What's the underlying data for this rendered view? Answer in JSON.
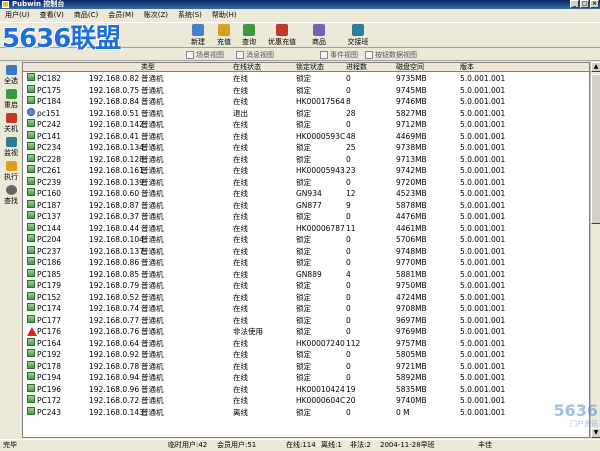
{
  "window": {
    "title": "Pubwin 控制台"
  },
  "menu": [
    "用户(U)",
    "查看(V)",
    "商品(C)",
    "会员(M)",
    "账次(Z)",
    "系统(S)",
    "帮助(H)"
  ],
  "logo": {
    "text": "5636联盟"
  },
  "toolbar": {
    "buttons": [
      {
        "label": "新建",
        "icon": "new-icon",
        "color": "#4a7fd0"
      },
      {
        "label": "充值",
        "icon": "recharge-icon",
        "color": "#d9a020"
      },
      {
        "label": "查询",
        "icon": "query-icon",
        "color": "#3c9a3c"
      },
      {
        "label": "优惠充值",
        "icon": "discount-icon",
        "color": "#c0392b"
      },
      {
        "label": "商品",
        "icon": "goods-icon",
        "color": "#7a5cc0"
      },
      {
        "label": "交接班",
        "icon": "handover-icon",
        "color": "#2f7d9a"
      }
    ]
  },
  "view_tabs": [
    "场景视图",
    "消息视图",
    "事件视图",
    "按钮数据视图"
  ],
  "sidebar": [
    {
      "label": "全选",
      "icon": "select-all-icon",
      "color": "#3a78c8"
    },
    {
      "label": "重启",
      "icon": "restart-icon",
      "color": "#3c9a3c"
    },
    {
      "label": "关机",
      "icon": "shutdown-icon",
      "color": "#c0392b"
    },
    {
      "label": "监视",
      "icon": "monitor-icon",
      "color": "#2f7d9a"
    },
    {
      "label": "执行",
      "icon": "execute-icon",
      "color": "#d9a020"
    },
    {
      "label": "查找",
      "icon": "search-icon",
      "color": "#666666"
    }
  ],
  "table": {
    "headers": [
      "类型",
      "在线状态",
      "锁定状态",
      "进程数",
      "磁盘空间",
      "版本"
    ],
    "rows": [
      {
        "name": "PC182",
        "ip": "192.168.0.82",
        "type": "普通机",
        "status": "在线",
        "lock": "锁定",
        "proc": "0",
        "disk": "9735MB",
        "ver": "5.0.001.001",
        "icon": "pc"
      },
      {
        "name": "PC175",
        "ip": "192.168.0.75",
        "type": "普通机",
        "status": "在线",
        "lock": "锁定",
        "proc": "0",
        "disk": "9745MB",
        "ver": "5.0.001.001",
        "icon": "pc"
      },
      {
        "name": "PC184",
        "ip": "192.168.0.84",
        "type": "普通机",
        "status": "在线",
        "lock": "HK00017564",
        "proc": "8",
        "disk": "9746MB",
        "ver": "5.0.001.001",
        "icon": "pc"
      },
      {
        "name": "pc151",
        "ip": "192.168.0.51",
        "type": "普通机",
        "status": "退出",
        "lock": "锁定",
        "proc": "28",
        "disk": "5827MB",
        "ver": "5.0.001.001",
        "icon": "user"
      },
      {
        "name": "PC242",
        "ip": "192.168.0.142",
        "type": "普通机",
        "status": "在线",
        "lock": "锁定",
        "proc": "0",
        "disk": "9712MB",
        "ver": "5.0.001.001",
        "icon": "pc"
      },
      {
        "name": "PC141",
        "ip": "192.168.0.41",
        "type": "普通机",
        "status": "在线",
        "lock": "HK0000593C",
        "proc": "48",
        "disk": "4469MB",
        "ver": "5.0.001.001",
        "icon": "pc"
      },
      {
        "name": "PC234",
        "ip": "192.168.0.134",
        "type": "普通机",
        "status": "在线",
        "lock": "锁定",
        "proc": "25",
        "disk": "9738MB",
        "ver": "5.0.001.001",
        "icon": "pc"
      },
      {
        "name": "PC228",
        "ip": "192.168.0.128",
        "type": "普通机",
        "status": "在线",
        "lock": "锁定",
        "proc": "0",
        "disk": "9713MB",
        "ver": "5.0.001.001",
        "icon": "pc"
      },
      {
        "name": "PC261",
        "ip": "192.168.0.161",
        "type": "普通机",
        "status": "在线",
        "lock": "HK00005943",
        "proc": "23",
        "disk": "9742MB",
        "ver": "5.0.001.001",
        "icon": "pc"
      },
      {
        "name": "PC239",
        "ip": "192.168.0.139",
        "type": "普通机",
        "status": "在线",
        "lock": "锁定",
        "proc": "0",
        "disk": "9720MB",
        "ver": "5.0.001.001",
        "icon": "pc"
      },
      {
        "name": "PC160",
        "ip": "192.168.0.60",
        "type": "普通机",
        "status": "在线",
        "lock": "GN934",
        "proc": "12",
        "disk": "4523MB",
        "ver": "5.0.001.001",
        "icon": "pc"
      },
      {
        "name": "PC187",
        "ip": "192.168.0.87",
        "type": "普通机",
        "status": "在线",
        "lock": "GN877",
        "proc": "9",
        "disk": "5878MB",
        "ver": "5.0.001.001",
        "icon": "pc"
      },
      {
        "name": "PC137",
        "ip": "192.168.0.37",
        "type": "普通机",
        "status": "在线",
        "lock": "锁定",
        "proc": "0",
        "disk": "4476MB",
        "ver": "5.0.001.001",
        "icon": "pc"
      },
      {
        "name": "PC144",
        "ip": "192.168.0.44",
        "type": "普通机",
        "status": "在线",
        "lock": "HK00006787",
        "proc": "11",
        "disk": "4461MB",
        "ver": "5.0.001.001",
        "icon": "pc"
      },
      {
        "name": "PC204",
        "ip": "192.168.0.104",
        "type": "普通机",
        "status": "在线",
        "lock": "锁定",
        "proc": "0",
        "disk": "5706MB",
        "ver": "5.0.001.001",
        "icon": "pc"
      },
      {
        "name": "PC237",
        "ip": "192.168.0.137",
        "type": "普通机",
        "status": "在线",
        "lock": "锁定",
        "proc": "0",
        "disk": "9748MB",
        "ver": "5.0.001.001",
        "icon": "pc"
      },
      {
        "name": "PC186",
        "ip": "192.168.0.86",
        "type": "普通机",
        "status": "在线",
        "lock": "锁定",
        "proc": "0",
        "disk": "9770MB",
        "ver": "5.0.001.001",
        "icon": "pc"
      },
      {
        "name": "PC185",
        "ip": "192.168.0.85",
        "type": "普通机",
        "status": "在线",
        "lock": "GN889",
        "proc": "4",
        "disk": "5881MB",
        "ver": "5.0.001.001",
        "icon": "pc"
      },
      {
        "name": "PC179",
        "ip": "192.168.0.79",
        "type": "普通机",
        "status": "在线",
        "lock": "锁定",
        "proc": "0",
        "disk": "9750MB",
        "ver": "5.0.001.001",
        "icon": "pc"
      },
      {
        "name": "PC152",
        "ip": "192.168.0.52",
        "type": "普通机",
        "status": "在线",
        "lock": "锁定",
        "proc": "0",
        "disk": "4724MB",
        "ver": "5.0.001.001",
        "icon": "pc"
      },
      {
        "name": "PC174",
        "ip": "192.168.0.74",
        "type": "普通机",
        "status": "在线",
        "lock": "锁定",
        "proc": "0",
        "disk": "9708MB",
        "ver": "5.0.001.001",
        "icon": "pc"
      },
      {
        "name": "PC177",
        "ip": "192.168.0.77",
        "type": "普通机",
        "status": "在线",
        "lock": "锁定",
        "proc": "0",
        "disk": "9697MB",
        "ver": "5.0.001.001",
        "icon": "pc"
      },
      {
        "name": "PC176",
        "ip": "192.168.0.76",
        "type": "普通机",
        "status": "非法使用",
        "lock": "锁定",
        "proc": "0",
        "disk": "9769MB",
        "ver": "5.0.001.001",
        "icon": "warn"
      },
      {
        "name": "PC164",
        "ip": "192.168.0.64",
        "type": "普通机",
        "status": "在线",
        "lock": "HK00007240",
        "proc": "112",
        "disk": "9757MB",
        "ver": "5.0.001.001",
        "icon": "pc"
      },
      {
        "name": "PC192",
        "ip": "192.168.0.92",
        "type": "普通机",
        "status": "在线",
        "lock": "锁定",
        "proc": "0",
        "disk": "5805MB",
        "ver": "5.0.001.001",
        "icon": "pc"
      },
      {
        "name": "PC178",
        "ip": "192.168.0.78",
        "type": "普通机",
        "status": "在线",
        "lock": "锁定",
        "proc": "0",
        "disk": "9721MB",
        "ver": "5.0.001.001",
        "icon": "pc"
      },
      {
        "name": "PC194",
        "ip": "192.168.0.94",
        "type": "普通机",
        "status": "在线",
        "lock": "锁定",
        "proc": "0",
        "disk": "5892MB",
        "ver": "5.0.001.001",
        "icon": "pc"
      },
      {
        "name": "PC196",
        "ip": "192.168.0.96",
        "type": "普通机",
        "status": "在线",
        "lock": "HK00010424",
        "proc": "19",
        "disk": "5835MB",
        "ver": "5.0.001.001",
        "icon": "pc"
      },
      {
        "name": "PC172",
        "ip": "192.168.0.72",
        "type": "普通机",
        "status": "在线",
        "lock": "HK0000604C",
        "proc": "20",
        "disk": "9740MB",
        "ver": "5.0.001.001",
        "icon": "pc"
      },
      {
        "name": "PC243",
        "ip": "192.168.0.143",
        "type": "普通机",
        "status": "离线",
        "lock": "锁定",
        "proc": "0",
        "disk": "0 M",
        "ver": "5.0.001.001",
        "icon": "pc"
      }
    ]
  },
  "status": {
    "left": "完毕",
    "temp_users": "临时用户:42",
    "member_users": "会员用户:51",
    "online": "在线:114",
    "offline": "离线:1",
    "illegal": "非法:2",
    "shift": "2004-11-28早班",
    "right": "丰佳"
  },
  "watermark": {
    "text": "5636",
    "sub": "门户资讯"
  }
}
